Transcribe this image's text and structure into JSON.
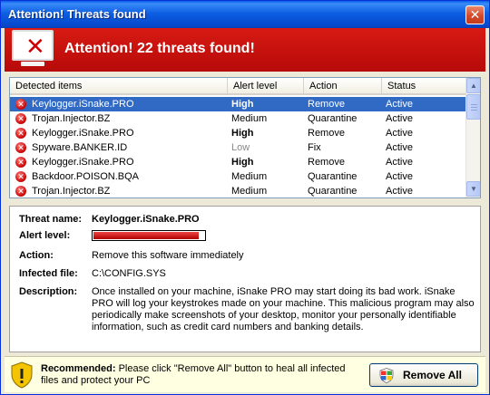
{
  "window": {
    "title": "Attention! Threats found",
    "close_glyph": "✕"
  },
  "header": {
    "headline": "Attention! 22 threats found!",
    "icon": "monitor-x-icon"
  },
  "table": {
    "columns": [
      "Detected items",
      "Alert level",
      "Action",
      "Status"
    ],
    "rows": [
      {
        "name": "Keylogger.iSnake.PRO",
        "level": "High",
        "action": "Remove",
        "status": "Active",
        "selected": true
      },
      {
        "name": "Trojan.Injector.BZ",
        "level": "Medium",
        "action": "Quarantine",
        "status": "Active"
      },
      {
        "name": "Keylogger.iSnake.PRO",
        "level": "High",
        "action": "Remove",
        "status": "Active"
      },
      {
        "name": "Spyware.BANKER.ID",
        "level": "Low",
        "action": "Fix",
        "status": "Active"
      },
      {
        "name": "Keylogger.iSnake.PRO",
        "level": "High",
        "action": "Remove",
        "status": "Active"
      },
      {
        "name": "Backdoor.POISON.BQA",
        "level": "Medium",
        "action": "Quarantine",
        "status": "Active"
      },
      {
        "name": "Trojan.Injector.BZ",
        "level": "Medium",
        "action": "Quarantine",
        "status": "Active"
      }
    ],
    "row_icon_glyph": "✕",
    "scroll_up_glyph": "▲",
    "scroll_down_glyph": "▼"
  },
  "details": {
    "threat_name_label": "Threat name:",
    "threat_name": "Keylogger.iSnake.PRO",
    "alert_level_label": "Alert level:",
    "alert_level_fraction": 0.95,
    "action_label": "Action:",
    "action": "Remove this software immediately",
    "infected_file_label": "Infected file:",
    "infected_file": "C:\\CONFIG.SYS",
    "description_label": "Description:",
    "description": "Once installed on your machine, iSnake PRO may start doing its bad work. iSnake PRO will log your keystrokes made on your machine. This malicious program may also periodically make screenshots of your desktop, monitor your personally identifiable information, such as credit card numbers and banking details."
  },
  "footer": {
    "recommended_label": "Recommended:",
    "recommended_text": "Please click \"Remove All\" button to heal all infected files and protect your PC",
    "remove_all_label": "Remove All"
  },
  "colors": {
    "header_red": "#c8100e",
    "selection_blue": "#316ac5",
    "footer_bg": "#ffffe1"
  }
}
